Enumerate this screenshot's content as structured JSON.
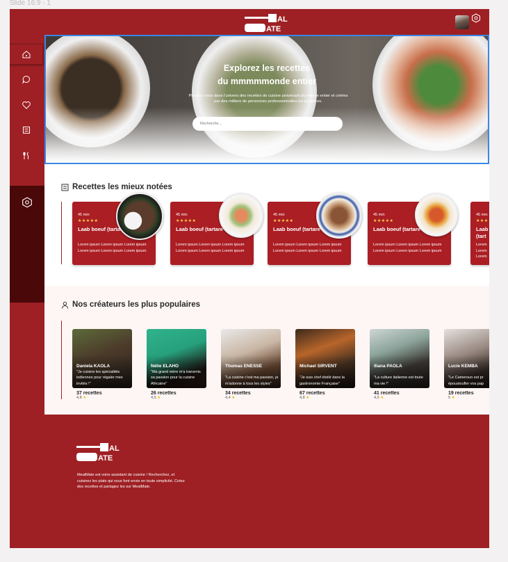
{
  "slide_label": "Slide 16:9 - 1",
  "brand": {
    "logo_text": "MEAL MATE",
    "accent": "#9e2024",
    "accent_dark": "#4a0809",
    "selection": "#3a86e6",
    "star": "#f2b705"
  },
  "sidebar": {
    "items": [
      {
        "icon": "home-icon"
      },
      {
        "icon": "chat-icon"
      },
      {
        "icon": "heart-icon"
      },
      {
        "icon": "recipe-book-icon"
      },
      {
        "icon": "cutlery-icon"
      },
      {
        "icon": "settings-icon"
      }
    ]
  },
  "hero": {
    "title_line1": "Explorez les recettes",
    "title_line2": "du mmmmmonde entier",
    "subtitle": "Plongez vous dans l'univers des recettes de cuisine provenant du monde entier et créées par des milliers de personnes professionnelles ou amatrices.",
    "search_placeholder": "Recherche..."
  },
  "top_rated": {
    "title": "Recettes les mieux notées",
    "cards": [
      {
        "time": "45 min",
        "stars": "★★★★★",
        "name": "Laab boeuf (tartare thaï)",
        "desc": "Lorem ipsum Lorem ipsum Lorem ipsum Lorem ipsum Lorem ipsum Lorem ipsum"
      },
      {
        "time": "45 min",
        "stars": "★★★★★",
        "name": "Laab boeuf (tartare thaï)",
        "desc": "Lorem ipsum Lorem ipsum Lorem ipsum Lorem ipsum Lorem ipsum Lorem ipsum"
      },
      {
        "time": "45 min",
        "stars": "★★★★★",
        "name": "Laab boeuf (tartare thaï)",
        "desc": "Lorem ipsum Lorem ipsum Lorem ipsum Lorem ipsum Lorem ipsum Lorem ipsum"
      },
      {
        "time": "45 min",
        "stars": "★★★★★",
        "name": "Laab boeuf (tartare thaï)",
        "desc": "Lorem ipsum Lorem ipsum Lorem ipsum Lorem ipsum Lorem ipsum Lorem ipsum"
      },
      {
        "time": "45 min",
        "stars": "★★★",
        "name": "Laab (tart",
        "desc": "Lorem Lorem Lorem"
      }
    ]
  },
  "creators": {
    "title": "Nos créateurs les plus populaires",
    "items": [
      {
        "name": "Daniela KAOLA",
        "quote": "\"Je cuisine les spécialités indiennes pour régaler mes invités !\"",
        "count": "37 recettes",
        "rating": "4,8"
      },
      {
        "name": "Nélie ELAHO",
        "quote": "\"Ma grand mère m'a transmis sa passion pour la cuisine Africaine\"",
        "count": "26 recettes",
        "rating": "4,5"
      },
      {
        "name": "Thomas ENESSE",
        "quote": "\"La cuisine c'est ma passion, je m'adonne à tous les styles\"",
        "count": "34 recettes",
        "rating": "4,4"
      },
      {
        "name": "Michael SIRVENT",
        "quote": "\"Je suis chef étoilé dans la gastronomie Française\"",
        "count": "67 recettes",
        "rating": "4,8"
      },
      {
        "name": "Iliana PAOLA",
        "quote": "\"La culture italienne est toute ma vie !\"",
        "count": "41 recettes",
        "rating": "4,5"
      },
      {
        "name": "Lucie KEMBA",
        "quote": "\"Le Cameroun est pr époustoufler vos pap",
        "count": "19 recettes",
        "rating": "5"
      }
    ]
  },
  "footer": {
    "text": "MealMate est votre assistant de cuisine ! Recherchez, et cuisinez les plats qui vous font envie en toute simplicité. Créez des recettes et partagez les sur MealMate."
  }
}
